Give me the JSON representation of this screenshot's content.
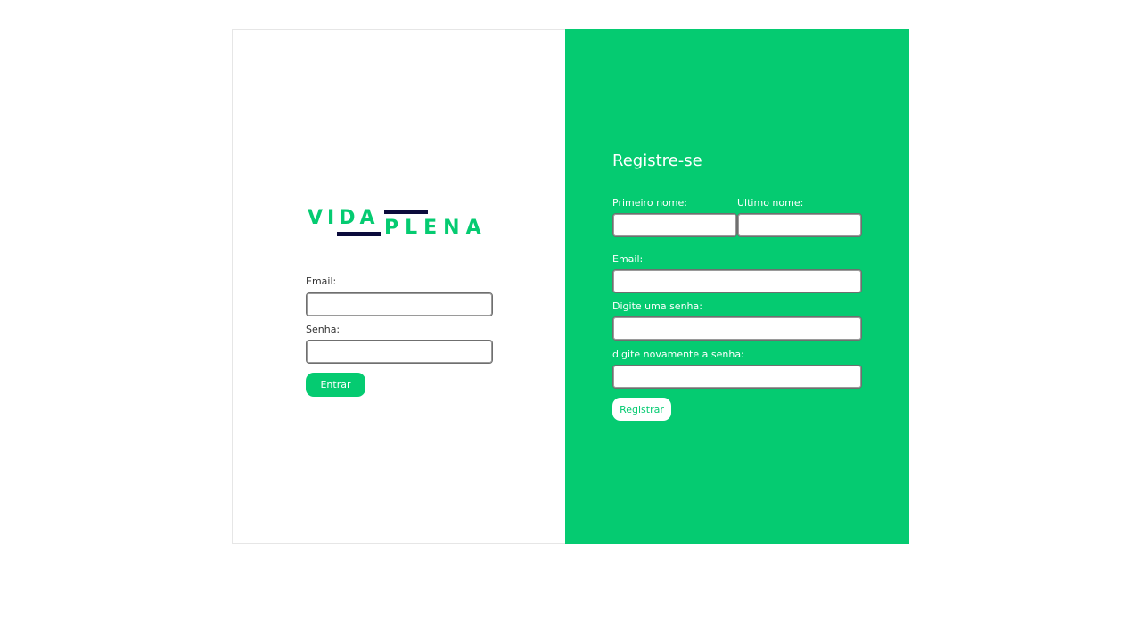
{
  "brand": {
    "logo_text_top": "VIDA",
    "logo_text_bottom": "PLENA",
    "accent_color": "#05cb71",
    "dark_color": "#0b0b3b"
  },
  "login": {
    "email_label": "Email:",
    "email_value": "",
    "password_label": "Senha:",
    "password_value": "",
    "submit_label": "Entrar"
  },
  "register": {
    "title": "Registre-se",
    "first_name_label": "Primeiro nome:",
    "first_name_value": "",
    "last_name_label": "Ultimo nome:",
    "last_name_value": "",
    "email_label": "Email:",
    "email_value": "",
    "password_label": "Digite uma senha:",
    "password_value": "",
    "confirm_password_label": "digite novamente a senha:",
    "confirm_password_value": "",
    "submit_label": "Registrar"
  }
}
